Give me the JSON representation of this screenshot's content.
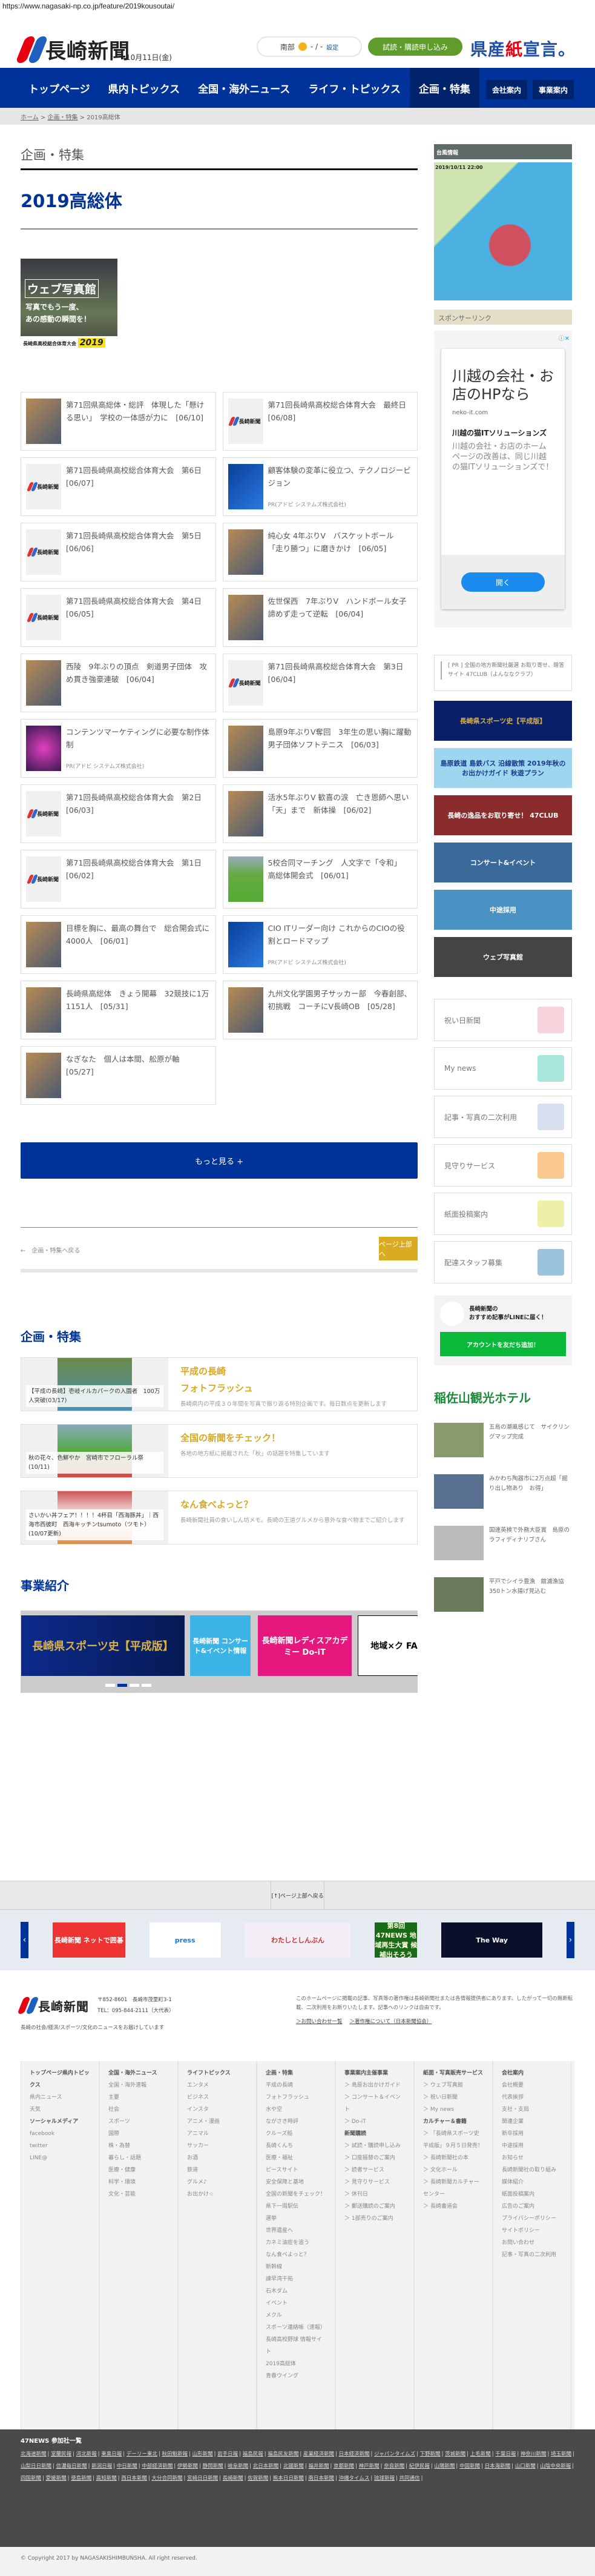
{
  "url": "https://www.nagasaki-np.co.jp/feature/2019kousoutai/",
  "header": {
    "logo": "長崎新聞",
    "date": "10月11日(金)",
    "weather_area": "南部",
    "weather_temp": "- / -",
    "weather_setting": "設定",
    "subscribe": "試読・購読申し込み",
    "declaration_pre": "県産",
    "declaration_red": "紙",
    "declaration_post": "宣言。"
  },
  "nav": {
    "items": [
      "トップページ",
      "県内トピックス",
      "全国・海外ニュース",
      "ライフ・トピックス",
      "企画・特集"
    ],
    "active": 4,
    "company": "会社案内",
    "business": "事業案内"
  },
  "breadcrumb": [
    "ホーム",
    "企画・特集",
    "2019高総体"
  ],
  "main": {
    "category": "企画・特集",
    "title": "2019高総体",
    "web_photo": {
      "title": "ウェブ写真館",
      "line1": "写真でもう一度、",
      "line2": "あの感動の瞬間を！",
      "foot": "長崎県高校総合体育大会",
      "year": "2019"
    },
    "articles": [
      {
        "t": "第71回県高総体・総評　体現した「懸ける思い」　学校の一体感が力に　[06/10]",
        "img": "photo"
      },
      {
        "t": "第71回長崎県高校総合体育大会　最終日　[06/08]",
        "img": "logo"
      },
      {
        "t": "第71回長崎県高校総合体育大会　第6日　[06/07]",
        "img": "logo"
      },
      {
        "t": "顧客体験の変革に役立つ、テクノロジービジョン",
        "img": "blue",
        "pr": "PR(アドビ システムズ株式会社)"
      },
      {
        "t": "第71回長崎県高校総合体育大会　第5日　[06/06]",
        "img": "logo"
      },
      {
        "t": "純心女 4年ぶりV　バスケットボール　「走り勝つ」に磨きかけ　[06/05]",
        "img": "photo"
      },
      {
        "t": "第71回長崎県高校総合体育大会　第4日　[06/05]",
        "img": "logo"
      },
      {
        "t": "佐世保西　7年ぶりV　ハンドボール女子　諦めず走って逆転　[06/04]",
        "img": "photo"
      },
      {
        "t": "西陵　9年ぶりの頂点　剣道男子団体　攻め貫き強豪連破　[06/04]",
        "img": "photo"
      },
      {
        "t": "第71回長崎県高校総合体育大会　第3日　[06/04]",
        "img": "logo"
      },
      {
        "t": "コンテンツマーケティングに必要な制作体制",
        "img": "purple",
        "pr": "PR(アドビ システムズ株式会社)"
      },
      {
        "t": "島原9年ぶりV奪回　3年生の思い胸に躍動　男子団体ソフトテニス　[06/03]",
        "img": "photo"
      },
      {
        "t": "第71回長崎県高校総合体育大会　第2日　[06/03]",
        "img": "logo"
      },
      {
        "t": "活水5年ぶりV 歓喜の涙　亡き恩師へ思い「天」まで　新体操　[06/02]",
        "img": "photo"
      },
      {
        "t": "第71回長崎県高校総合体育大会　第1日　[06/02]",
        "img": "logo"
      },
      {
        "t": "5校合同マーチング　人文字で「令和」　高総体開会式　[06/01]",
        "img": "green"
      },
      {
        "t": "目標を胸に、最高の舞台で　総合開会式に4000人　[06/01]",
        "img": "photo"
      },
      {
        "t": "CIO ITリーダー向け これからのCIOの役割とロードマップ",
        "img": "blue",
        "pr": "PR(アドビ システムズ株式会社)"
      },
      {
        "t": "長崎県高総体　きょう開幕　32競技に1万1151人　[05/31]",
        "img": "photo"
      },
      {
        "t": "九州文化学園男子サッカー部　今春創部、初挑戦　コーチにV長崎OB　[05/28]",
        "img": "photo"
      },
      {
        "t": "なぎなた　個人は本間、舩原が軸　[05/27]",
        "img": "photo"
      }
    ],
    "more": "もっと見る +",
    "back": "←　企画・特集へ戻る",
    "page_top": "ページ上部へ"
  },
  "features": {
    "heading": "企画・特集",
    "items": [
      {
        "caption": "【平成の長崎】壱岐イルカパークの入園者　100万人突破(03/17)",
        "title1": "平成の長崎",
        "title2": "フォトフラッシュ",
        "desc": "長崎県内の平成３０年間を写真で振り返る特別企画です。毎日数点を更新します"
      },
      {
        "caption": "秋の花々、色鮮やか　宮崎市でフローラル祭 (10/11)",
        "title1": "全国の新聞をチェック！",
        "title2": "",
        "desc": "各地の地方紙に掲載された「秋」の話題を特集しています"
      },
      {
        "caption": "さいかい丼フェア！！！！4杯目「西海豚丼」｜西海市西彼町　西海キッチンtsumoto（ツモト）(10/07更新)",
        "title1": "なん食べよっと？",
        "title2": "",
        "desc": "長崎新聞社員の食いしん坊メモ。長崎の王道グルメから意外な食べ物までご紹介します"
      }
    ]
  },
  "business": {
    "heading": "事業紹介",
    "banners": [
      "長崎県スポーツ史【平成版】",
      "長崎新聞 コンサート&イベント情報",
      "長崎新聞レディスアカデミー Do-iT",
      "地域×ク FA"
    ],
    "active_dot": 1
  },
  "sidebar": {
    "typhoon": "台風情報",
    "typhoon_time": "2019/10/11 22:00",
    "sponsor": "スポンサーリンク",
    "ad": {
      "headline": "川越の会社・お店のHPなら",
      "domain": "neko-it.com",
      "name": "川越の猫ITソリューションズ",
      "desc": "川越の会社・お店のホームページの改善は、同じ川越の猫ITソリューションズで！",
      "button": "開く"
    },
    "pr": "[ PR ] 全国の地方新聞社厳選 お取り寄せ、贈答サイト 47CLUB（よんななクラブ）",
    "banners": [
      "長崎県スポーツ史【平成版】",
      "島原鉄道 島鉄バス 沿線散策 2019年秋のお出かけガイド 秋遊プラン",
      "長崎の逸品をお取り寄せ！ 47CLUB",
      "コンサート&イベント",
      "中途採用",
      "ウェブ写真館"
    ],
    "links": [
      {
        "label": "祝い日新聞",
        "color": "#f9d3dc"
      },
      {
        "label": "My news",
        "color": "#a6e6dc"
      },
      {
        "label": "記事・写真の二次利用",
        "color": "#d6e0ee"
      },
      {
        "label": "見守りサービス",
        "color": "#fbc98f"
      },
      {
        "label": "紙面投稿案内",
        "color": "#eef0a8"
      },
      {
        "label": "配達スタッフ募集",
        "color": "#9cc3dc"
      }
    ],
    "line": {
      "text1": "長崎新聞の",
      "text2": "おすすめ記事がLINEに届く！",
      "button": "アカウントを友だち追加！"
    },
    "hotel": "稲佐山観光ホテル",
    "news": [
      "五島の潮風感じて　サイクリングマップ完成",
      "みかわち陶器市に2万点超「掘り出し物あり　お得」",
      "国連英検で外務大臣賞　島原のラフィディナリブさん",
      "平戸でシイラ豊漁　舘浦漁協　350トン水揚げ見込む"
    ]
  },
  "footer": {
    "to_top": "[↑]ページ上部へ戻る",
    "banners": [
      "長崎新聞 ネットで囲碁",
      "press",
      "わたしとしんぶん",
      "第8回 47NEWS 地域再生大賞 候補出そろう",
      "The Way"
    ],
    "postal": "〒852-8601　長崎市茂里町3-1",
    "tel": "TEL：095-844-2111（大代表）",
    "tagline": "長崎の社会/経済/スポーツ/文化のニュースをお届けしています",
    "copyright_note": "このホームページに掲載の記事、写真等の著作権は長崎新聞社または各情報提供者にあります。したがって一切の無断転載、二次利用をお断りいたします。記事へのリンクは自由です。",
    "contact": "＞お問い合わせ一覧",
    "copyright_link": "＞著作権について（日本新聞協会）",
    "sitemap": [
      {
        "groups": [
          {
            "h": "トップページ",
            "items": []
          },
          {
            "h": "県内トピックス",
            "items": [
              "県内ニュース",
              "天気"
            ]
          },
          {
            "h": "ソーシャルメディア",
            "items": [
              "facebook",
              "twitter",
              "LINE@"
            ]
          }
        ]
      },
      {
        "groups": [
          {
            "h": "全国・海外ニュース",
            "items": [
              "全国・海外速報",
              "主要",
              "社会",
              "スポーツ",
              "国際",
              "株・為替",
              "暮らし・話題",
              "医療・健康",
              "科学・環境",
              "文化・芸能"
            ]
          }
        ]
      },
      {
        "groups": [
          {
            "h": "ライフトピックス",
            "items": [
              "エンタメ",
              "ビジネス",
              "インスタ",
              "アニメ・漫画",
              "アニマル",
              "サッカー",
              "お酒",
              "鉄道",
              "グルメ♪",
              "お出かけ☆"
            ]
          }
        ]
      },
      {
        "groups": [
          {
            "h": "企画・特集",
            "items": [
              "平成の長崎",
              "フォトフラッシュ",
              "水や空",
              "ながさき時評",
              "クルーズ船",
              "長崎くんち",
              "医療・福祉",
              "ピースサイト",
              "安全保障と基地",
              "全国の新聞をチェック！",
              "県下一周駅伝",
              "選挙",
              "世界遺産へ",
              "カネミ油症を追う",
              "なん食べよっと？",
              "新幹線",
              "諫早湾干拓",
              "石木ダム",
              "イベント",
              "メクル",
              "スポーツ連絡帳（速報）",
              "長崎高校野球 情報サイト",
              "2019高総体",
              "青春ウイング"
            ]
          }
        ]
      },
      {
        "groups": [
          {
            "h": "事業案内",
            "items": []
          },
          {
            "h": "主催事業",
            "items": [
              "＞ 島原お出かけガイド",
              "＞ コンサート＆イベント",
              "＞ Do-iT"
            ]
          },
          {
            "h": "新聞購読",
            "items": [
              "＞ 試読・購読申し込み",
              "＞ 口座振替のご案内",
              "＞ 読者サービス",
              "＞ 見守りサービス",
              "＞ 休刊日",
              "＞ 郵送購読のご案内",
              "＞ 1部売りのご案内"
            ]
          }
        ]
      },
      {
        "groups": [
          {
            "h": "紙面・写真販売サービス",
            "items": [
              "＞ ウェブ写真館",
              "＞ 祝い日新聞",
              "＞ My news"
            ]
          },
          {
            "h": "カルチャー＆書籍",
            "items": [
              "＞ 「長崎県スポーツ史 平成版」９月５日発売！",
              "＞ 長崎新聞社の本",
              "＞ 文化ホール",
              "＞ 長崎新聞カルチャーセンター",
              "＞ 長崎書道会"
            ]
          }
        ]
      },
      {
        "groups": [
          {
            "h": "会社案内",
            "items": [
              "会社概要",
              "代表挨拶",
              "支社・支局",
              "関連企業",
              "新卒採用",
              "中途採用",
              "お知らせ",
              "長崎新聞社の取り組み",
              "媒体紹介",
              "紙面投稿案内",
              "広告のご案内",
              "プライバシーポリシー",
              "サイトポリシー",
              "お問い合わせ",
              "記事・写真の二次利用"
            ]
          }
        ]
      }
    ],
    "n47_heading": "47NEWS 参加社一覧",
    "n47": [
      "北海道新聞",
      "室蘭民報",
      "河北新報",
      "東奥日報",
      "デーリー東北",
      "秋田魁新報",
      "山形新聞",
      "岩手日報",
      "福島民報",
      "福島民友新聞",
      "産業経済新聞",
      "日本経済新聞",
      "ジャパンタイムズ",
      "下野新聞",
      "茨城新聞",
      "上毛新聞",
      "千葉日報",
      "神奈川新聞",
      "埼玉新聞",
      "山梨日日新聞",
      "信濃毎日新聞",
      "新潟日報",
      "中日新聞",
      "中部経済新聞",
      "伊勢新聞",
      "静岡新聞",
      "岐阜新聞",
      "北日本新聞",
      "北國新聞",
      "福井新聞",
      "京都新聞",
      "神戸新聞",
      "奈良新聞",
      "紀伊民報",
      "山陽新聞",
      "中国新聞",
      "日本海新聞",
      "山口新聞",
      "山陰中央新報",
      "四国新聞",
      "愛媛新聞",
      "徳島新聞",
      "高知新聞",
      "西日本新聞",
      "大分合同新聞",
      "宮崎日日新聞",
      "長崎新聞",
      "佐賀新聞",
      "熊本日日新聞",
      "南日本新聞",
      "沖縄タイムス",
      "琉球新報",
      "共同通信"
    ],
    "copyright": "© Copyright 2017 by NAGASAKISHIMBUNSHA. All right reserved."
  }
}
